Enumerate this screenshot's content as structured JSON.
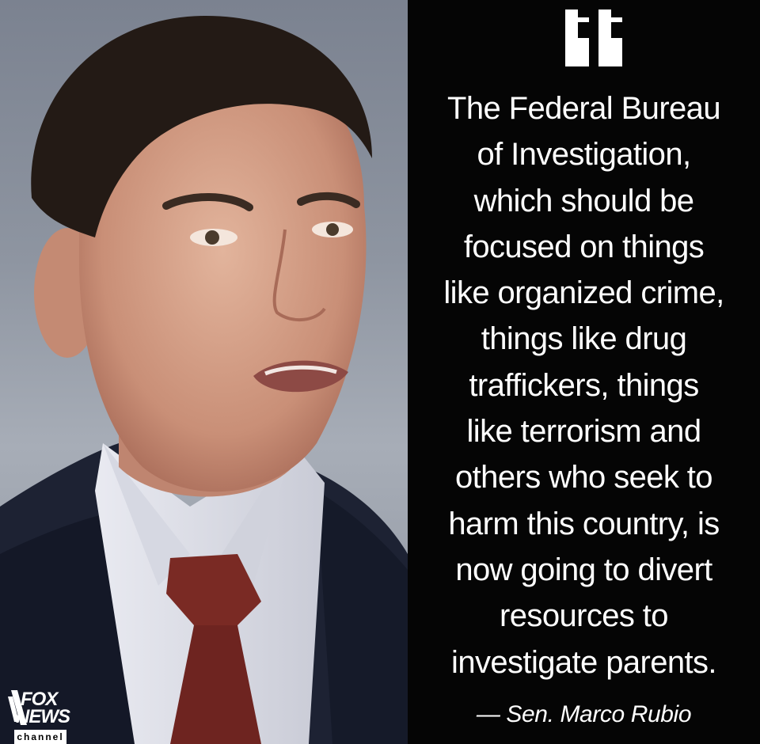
{
  "quote": {
    "lines": [
      "The Federal Bureau",
      "of Investigation,",
      "which should be",
      "focused on things",
      "like organized crime,",
      "things like drug",
      "traffickers, things",
      "like terrorism and",
      "others who seek to",
      "harm this country, is",
      "now going to divert",
      "resources to",
      "investigate parents."
    ],
    "attribution": "— Sen. Marco Rubio"
  },
  "logo": {
    "fox": "FOX",
    "news": "NEWS",
    "channel": "channel"
  },
  "colors": {
    "panel": "#050505",
    "text": "#ffffff",
    "suit": "#1d2233",
    "tie": "#7a2a24"
  }
}
